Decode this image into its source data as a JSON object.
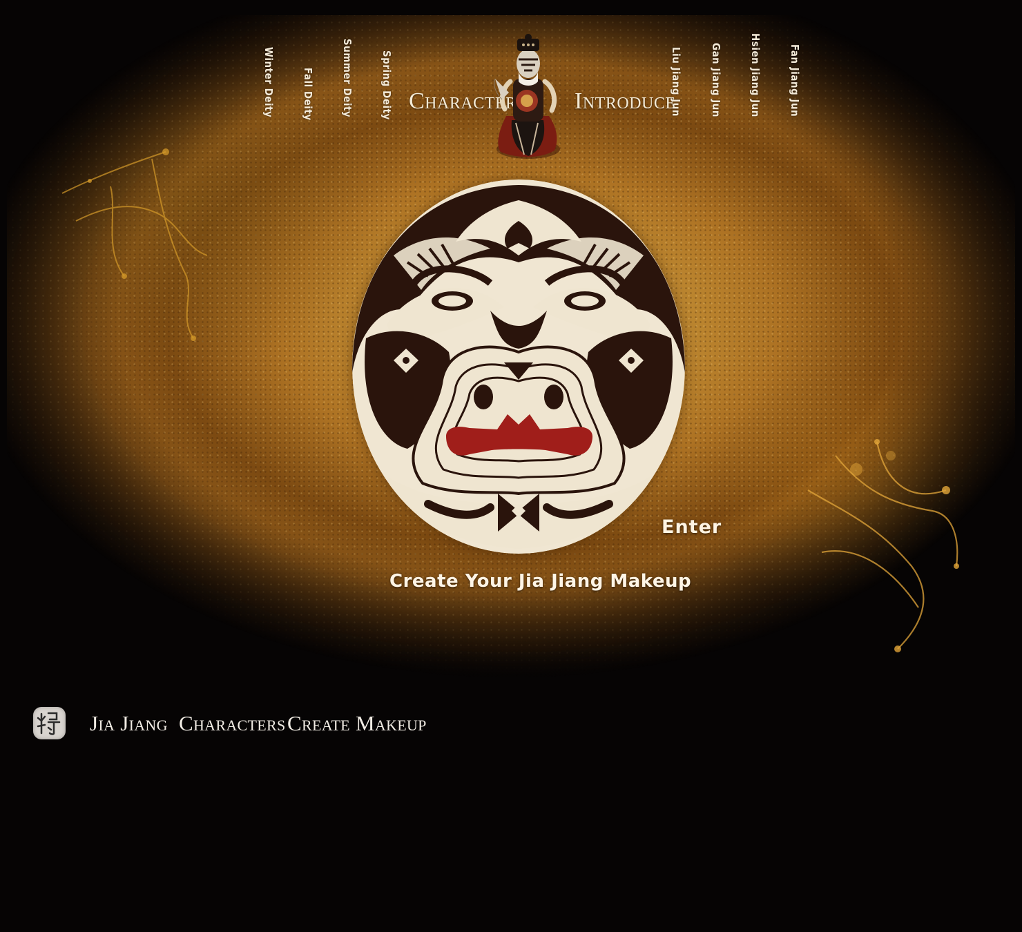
{
  "header": {
    "left_items": [
      "Winter Deity",
      "Fall Deity",
      "Summer Deity",
      "Spring Deity"
    ],
    "title_left": "Character",
    "title_right": "Introduce",
    "right_items": [
      "Liu Jiang Jun",
      "Gan Jiang Jun",
      "Hsien Jiang Jun",
      "Fan Jiang Jun"
    ]
  },
  "hero": {
    "image": "jia-jiang-face-mask",
    "enter_label": "Enter",
    "cta_label": "Create Your Jia Jiang Makeup"
  },
  "footer_nav": {
    "logo": "jiang-seal-logo",
    "items": [
      "Jia Jiang",
      "Characters",
      "Create Makeup"
    ]
  },
  "colors": {
    "background": "#060404",
    "gold": "#c79a45",
    "text": "#f4ead8",
    "mask_red": "#a01e1a",
    "mask_dark": "#2a140c",
    "mask_cream": "#efe5d0"
  }
}
